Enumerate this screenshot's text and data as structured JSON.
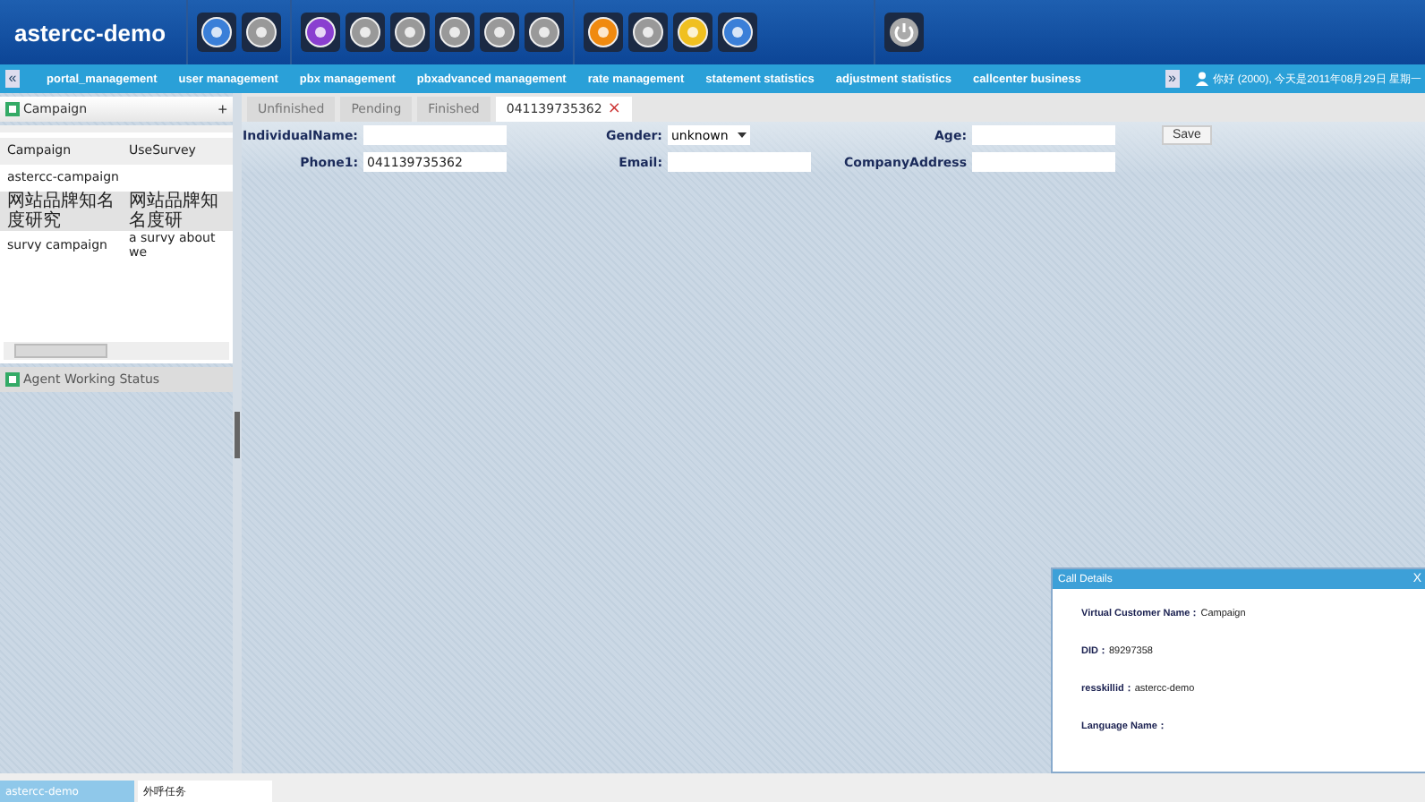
{
  "app": {
    "title": "astercc-demo"
  },
  "nav": {
    "collapse": "«",
    "items": [
      "portal_management",
      "user management",
      "pbx management",
      "pbxadvanced management",
      "rate management",
      "statement statistics",
      "adjustment statistics",
      "callcenter business"
    ],
    "expand": "»",
    "greeting": "你好 (2000), 今天是2011年08月29日 星期一"
  },
  "sidebar": {
    "campaign_panel": {
      "title": "Campaign",
      "add": "+",
      "columns": [
        "Campaign",
        "UseSurvey"
      ],
      "rows": [
        {
          "campaign": "astercc-campaign",
          "selected": false
        },
        {
          "campaign": "网站品牌知名度研究",
          "survey": "网站品牌知名度研",
          "selected": true
        },
        {
          "campaign": "survy campaign",
          "survey": "a survy about we",
          "selected": false
        }
      ]
    },
    "agent_panel": {
      "title": "Agent Working Status"
    }
  },
  "tabs": [
    {
      "label": "Unfinished",
      "selected": false
    },
    {
      "label": "Pending",
      "selected": false
    },
    {
      "label": "Finished",
      "selected": false
    },
    {
      "label": "041139735362",
      "selected": true,
      "close": "×"
    }
  ],
  "form": {
    "fields": [
      {
        "label": "IndividualName:",
        "kind": "input"
      },
      {
        "label": "Gender:",
        "kind": "select",
        "value": "unknown"
      },
      {
        "label": "Age:",
        "kind": "input"
      },
      {
        "label": "Phone1:",
        "kind": "input",
        "value": "041139735362"
      },
      {
        "label": "Email:",
        "kind": "input"
      },
      {
        "label": "CompanyAddress",
        "kind": "input"
      }
    ],
    "save": "Save"
  },
  "call_details": {
    "title": "Call Details",
    "close": "X",
    "lines": [
      {
        "label": "Virtual Customer Name：",
        "value": "Campaign"
      },
      {
        "label": "DID：",
        "value": "89297358"
      },
      {
        "label": "resskillid：",
        "value": "astercc-demo"
      },
      {
        "label": "Language Name："
      }
    ]
  },
  "taskbar": [
    {
      "label": "astercc-demo",
      "selected": true
    },
    {
      "label": "外呼任务",
      "selected": false
    }
  ]
}
